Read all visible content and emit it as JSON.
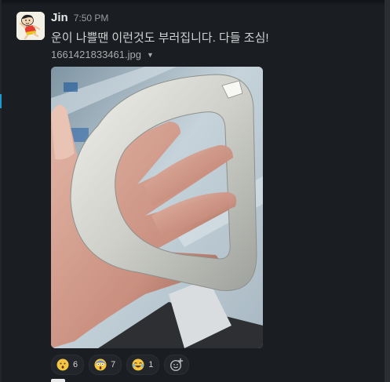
{
  "message": {
    "author": "Jin",
    "time": "7:50 PM",
    "text": "운이 나쁠땐 이런것도 부러집니다. 다들 조심!",
    "avatar_icon": "crayon-shin-chan-avatar-icon",
    "attachment": {
      "filename": "1661421833461.jpg",
      "image_icon": "broken-ring-photo"
    }
  },
  "reactions": [
    {
      "emoji": "hushed-face-icon",
      "count": "6"
    },
    {
      "emoji": "screaming-in-fear-face-icon",
      "count": "7"
    },
    {
      "emoji": "joy-face-icon",
      "count": "1"
    }
  ],
  "add_reaction_icon": "add-emoji-icon",
  "colors": {
    "background": "#1a1d21",
    "text": "#d1d2d3",
    "muted": "#9a9b9d",
    "accent": "#1d9bd1",
    "pill": "#222529"
  }
}
